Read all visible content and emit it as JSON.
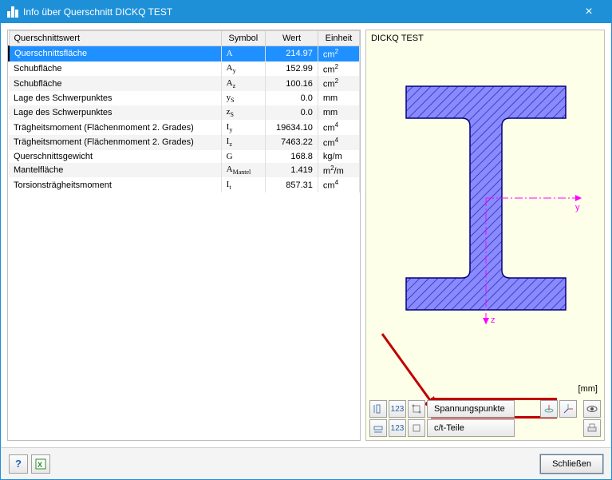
{
  "window": {
    "title": "Info über Querschnitt DICKQ TEST"
  },
  "table": {
    "headers": {
      "name": "Querschnittswert",
      "symbol": "Symbol",
      "value": "Wert",
      "unit": "Einheit"
    },
    "rows": [
      {
        "name": "Querschnittsfläche",
        "sym": "A",
        "sub": "",
        "val": "214.97",
        "unit": "cm",
        "usup": "2",
        "sel": true
      },
      {
        "name": "Schubfläche",
        "sym": "A",
        "sub": "y",
        "val": "152.99",
        "unit": "cm",
        "usup": "2"
      },
      {
        "name": "Schubfläche",
        "sym": "A",
        "sub": "z",
        "val": "100.16",
        "unit": "cm",
        "usup": "2"
      },
      {
        "name": "Lage des Schwerpunktes",
        "sym": "y",
        "sub": "S",
        "val": "0.0",
        "unit": "mm",
        "usup": ""
      },
      {
        "name": "Lage des Schwerpunktes",
        "sym": "z",
        "sub": "S",
        "val": "0.0",
        "unit": "mm",
        "usup": ""
      },
      {
        "name": "Trägheitsmoment (Flächenmoment 2. Grades)",
        "sym": "I",
        "sub": "y",
        "val": "19634.10",
        "unit": "cm",
        "usup": "4"
      },
      {
        "name": "Trägheitsmoment (Flächenmoment 2. Grades)",
        "sym": "I",
        "sub": "z",
        "val": "7463.22",
        "unit": "cm",
        "usup": "4"
      },
      {
        "name": "Querschnittsgewicht",
        "sym": "G",
        "sub": "",
        "val": "168.8",
        "unit": "kg/m",
        "usup": ""
      },
      {
        "name": "Mantelfläche",
        "sym": "A",
        "sub": "Mantel",
        "val": "1.419",
        "unit": "m",
        "usup": "2",
        "utail": "/m"
      },
      {
        "name": "Torsionsträgheitsmoment",
        "sym": "I",
        "sub": "t",
        "val": "857.31",
        "unit": "cm",
        "usup": "4"
      }
    ]
  },
  "preview": {
    "title": "DICKQ TEST",
    "unit_label": "[mm]",
    "axis_y": "y",
    "axis_z": "z"
  },
  "toolbar": {
    "spannungspunkte": "Spannungspunkte",
    "ct_teile": "c/t-Teile"
  },
  "footer": {
    "close": "Schließen"
  }
}
